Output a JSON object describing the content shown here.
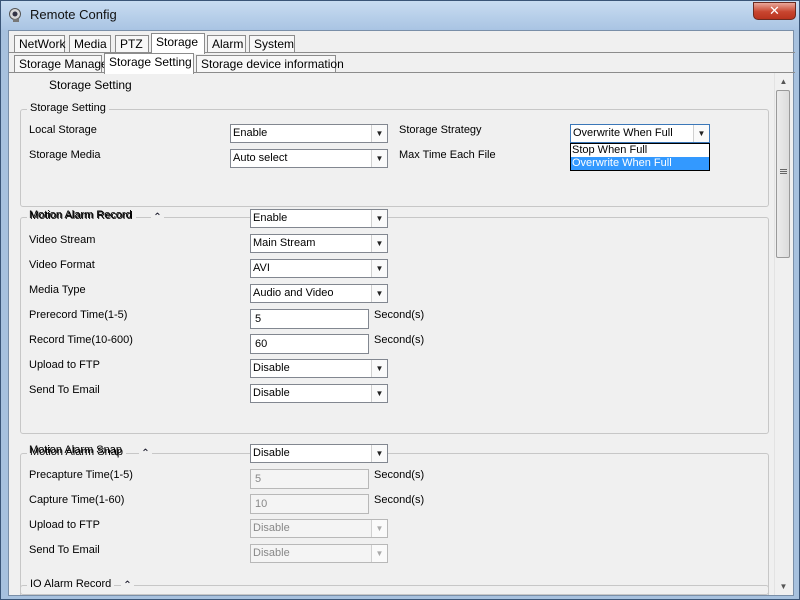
{
  "window": {
    "title": "Remote Config",
    "close_label": "✕"
  },
  "tabs": [
    {
      "label": "NetWork"
    },
    {
      "label": "Media"
    },
    {
      "label": "PTZ"
    },
    {
      "label": "Storage"
    },
    {
      "label": "Alarm"
    },
    {
      "label": "System"
    }
  ],
  "active_tab": "Storage",
  "subtabs": [
    {
      "label": "Storage Manage"
    },
    {
      "label": "Storage Setting"
    },
    {
      "label": "Storage device information"
    }
  ],
  "active_subtab": "Storage Setting",
  "page_title": "Storage Setting",
  "storage_setting": {
    "group_title": "Storage Setting",
    "local_storage": {
      "label": "Local Storage",
      "value": "Enable"
    },
    "storage_media": {
      "label": "Storage Media",
      "value": "Auto select"
    },
    "storage_strategy": {
      "label": "Storage Strategy",
      "value": "Overwrite When Full",
      "options": [
        "Stop When Full",
        "Overwrite When Full"
      ],
      "highlighted": "Overwrite When Full"
    },
    "max_time": {
      "label": "Max Time Each File"
    }
  },
  "motion_record": {
    "group_title": "Motion Alarm Record",
    "motion_alarm_record": {
      "label": "Motion Alarm Record",
      "value": "Enable"
    },
    "video_stream": {
      "label": "Video Stream",
      "value": "Main Stream"
    },
    "video_format": {
      "label": "Video Format",
      "value": "AVI"
    },
    "media_type": {
      "label": "Media Type",
      "value": "Audio and Video"
    },
    "prerecord": {
      "label": "Prerecord Time(1-5)",
      "value": "5",
      "unit": "Second(s)"
    },
    "record_time": {
      "label": "Record Time(10-600)",
      "value": "60",
      "unit": "Second(s)"
    },
    "upload_ftp": {
      "label": "Upload to FTP",
      "value": "Disable"
    },
    "send_email": {
      "label": "Send To Email",
      "value": "Disable"
    }
  },
  "motion_snap": {
    "group_title": "Motion Alarm Snap",
    "motion_alarm_snap": {
      "label": "Motion Alarm Snap",
      "value": "Disable"
    },
    "precapture": {
      "label": "Precapture Time(1-5)",
      "value": "5",
      "unit": "Second(s)"
    },
    "capture": {
      "label": "Capture Time(1-60)",
      "value": "10",
      "unit": "Second(s)"
    },
    "upload_ftp": {
      "label": "Upload to FTP",
      "value": "Disable"
    },
    "send_email": {
      "label": "Send To Email",
      "value": "Disable"
    }
  },
  "io_record": {
    "group_title": "IO Alarm Record"
  },
  "icons": {
    "collapse": "double-chevron-up-icon",
    "dropdown": "triangle-down-icon",
    "app": "camera-icon"
  },
  "colors": {
    "highlight": "#3399ff",
    "close": "#c8452f",
    "frame": "#a7c1de"
  }
}
